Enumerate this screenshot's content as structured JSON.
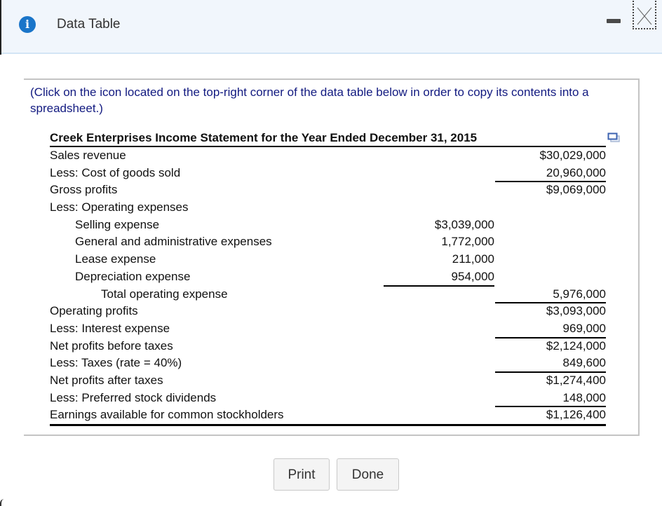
{
  "window": {
    "title": "Data Table",
    "icons": {
      "info": "info-icon",
      "minimize": "minimize-icon",
      "close": "close-icon",
      "copy": "copy-to-spreadsheet-icon"
    }
  },
  "instructions": "(Click on the icon located on the top-right corner of the data table below in order to copy its contents into a spreadsheet.)",
  "statement": {
    "title": "Creek Enterprises Income Statement for the Year Ended December 31, 2015",
    "rows": [
      {
        "label": "Sales revenue",
        "col1": "",
        "col2": "$30,029,000"
      },
      {
        "label": "Less: Cost of goods sold",
        "col1": "",
        "col2": "20,960,000"
      },
      {
        "label": "Gross profits",
        "col1": "",
        "col2": "$9,069,000"
      },
      {
        "label": "Less: Operating expenses",
        "col1": "",
        "col2": ""
      },
      {
        "label": "Selling expense",
        "col1": "$3,039,000",
        "col2": ""
      },
      {
        "label": "General and administrative expenses",
        "col1": "1,772,000",
        "col2": ""
      },
      {
        "label": "Lease expense",
        "col1": "211,000",
        "col2": ""
      },
      {
        "label": "Depreciation expense",
        "col1": "954,000",
        "col2": ""
      },
      {
        "label": "Total operating expense",
        "col1": "",
        "col2": "5,976,000"
      },
      {
        "label": "Operating profits",
        "col1": "",
        "col2": "$3,093,000"
      },
      {
        "label": "Less: Interest expense",
        "col1": "",
        "col2": "969,000"
      },
      {
        "label": "Net profits before taxes",
        "col1": "",
        "col2": "$2,124,000"
      },
      {
        "label": "Less: Taxes (rate = 40%)",
        "col1": "",
        "col2": "849,600"
      },
      {
        "label": "Net profits after taxes",
        "col1": "",
        "col2": "$1,274,400"
      },
      {
        "label": "Less: Preferred stock dividends",
        "col1": "",
        "col2": "148,000"
      },
      {
        "label": "Earnings available for common stockholders",
        "col1": "",
        "col2": "$1,126,400"
      }
    ]
  },
  "buttons": {
    "print": "Print",
    "done": "Done"
  }
}
